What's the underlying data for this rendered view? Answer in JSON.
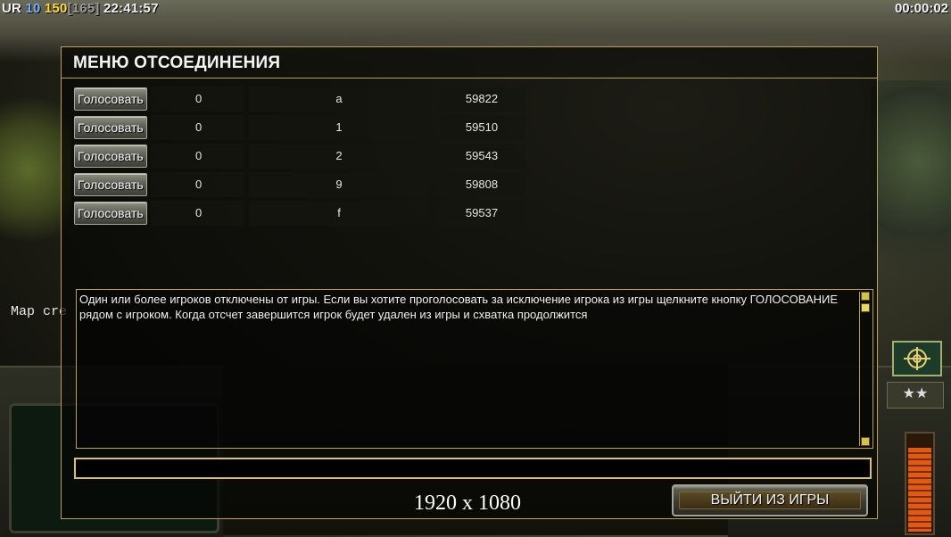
{
  "hud": {
    "faction": "UR",
    "level": "10",
    "money": "150",
    "capacity": "[165]",
    "clock": "22:41:57",
    "match_timer": "00:00:02",
    "map_created_text": "Map cre"
  },
  "dialog": {
    "title": "МЕНЮ ОТСОЕДИНЕНИЯ",
    "vote_label": "Голосовать",
    "players": [
      {
        "votes": "0",
        "name": "a",
        "ping": "59822"
      },
      {
        "votes": "0",
        "name": "1",
        "ping": "59510"
      },
      {
        "votes": "0",
        "name": "2",
        "ping": "59543"
      },
      {
        "votes": "0",
        "name": "9",
        "ping": "59808"
      },
      {
        "votes": "0",
        "name": "f",
        "ping": "59537"
      }
    ],
    "message": "Один или более игроков отключены от игры. Если вы хотите проголосовать за исключение игрока из игры щелкните кнопку ГОЛОСОВАНИЕ рядом с игроком. Когда отсчет завершится игрок будет удален из игры и схватка продолжится",
    "chat_value": "",
    "resolution": "1920 x 1080",
    "quit_label": "ВЫЙТИ ИЗ ИГРЫ"
  },
  "colors": {
    "accent_gold": "#b8a24a",
    "money_yellow": "#ffd93a",
    "level_blue": "#6fb3ff"
  },
  "icons": [
    "radar-icon",
    "star-rank-icon",
    "power-meter-icon"
  ]
}
